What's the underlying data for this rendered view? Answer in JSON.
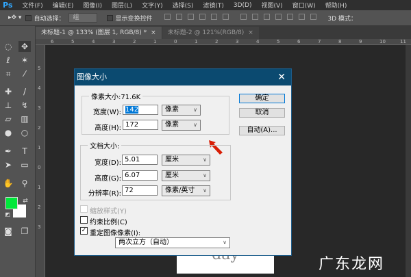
{
  "app": {
    "logo": "Ps"
  },
  "menu": [
    "文件(F)",
    "编辑(E)",
    "图像(I)",
    "图层(L)",
    "文字(Y)",
    "选择(S)",
    "滤镜(T)",
    "3D(D)",
    "视图(V)",
    "窗口(W)",
    "帮助(H)"
  ],
  "options": {
    "auto_select": "自动选择：",
    "auto_select_value": "组",
    "show_transform": "显示变换控件",
    "mode_3d": "3D 模式："
  },
  "tabs": [
    {
      "label": "未标题-1 @ 133% (图层 1, RGB/8) *",
      "active": true
    },
    {
      "label": "未标题-2 @ 121%(RGB/8)",
      "active": false
    }
  ],
  "ruler_top": [
    "6",
    "5",
    "4",
    "3",
    "2",
    "1",
    "0",
    "1",
    "2",
    "3",
    "4",
    "5",
    "6",
    "7",
    "8",
    "9",
    "10",
    "11"
  ],
  "ruler_left": [
    "5",
    "4",
    "3",
    "2",
    "1",
    "0",
    "1",
    "2",
    "3"
  ],
  "colors": {
    "foreground": "#00e83a",
    "background": "#ffffff",
    "dialog_title": "#0b4a70",
    "arrow": "#d81e06"
  },
  "dialog": {
    "title": "图像大小",
    "pixel_group": {
      "legend": "像素大小:71.6K",
      "width_label": "宽度(W):",
      "width_value": "142",
      "width_unit": "像素",
      "height_label": "高度(H):",
      "height_value": "172",
      "height_unit": "像素"
    },
    "doc_group": {
      "legend": "文档大小:",
      "width_label": "宽度(D):",
      "width_value": "5.01",
      "width_unit": "厘米",
      "height_label": "高度(G):",
      "height_value": "6.07",
      "height_unit": "厘米",
      "res_label": "分辨率(R):",
      "res_value": "72",
      "res_unit": "像素/英寸"
    },
    "buttons": {
      "ok": "确定",
      "cancel": "取消",
      "auto": "自动(A)..."
    },
    "scale_styles": {
      "label": "缩放样式(Y)",
      "checked": false,
      "disabled": true
    },
    "constrain": {
      "label": "约束比例(C)",
      "checked": false
    },
    "resample": {
      "label": "重定图像像素(I):",
      "checked": true
    },
    "resample_method": "两次立方（自动）"
  },
  "canvas_text": "day",
  "watermark": "广东龙网"
}
